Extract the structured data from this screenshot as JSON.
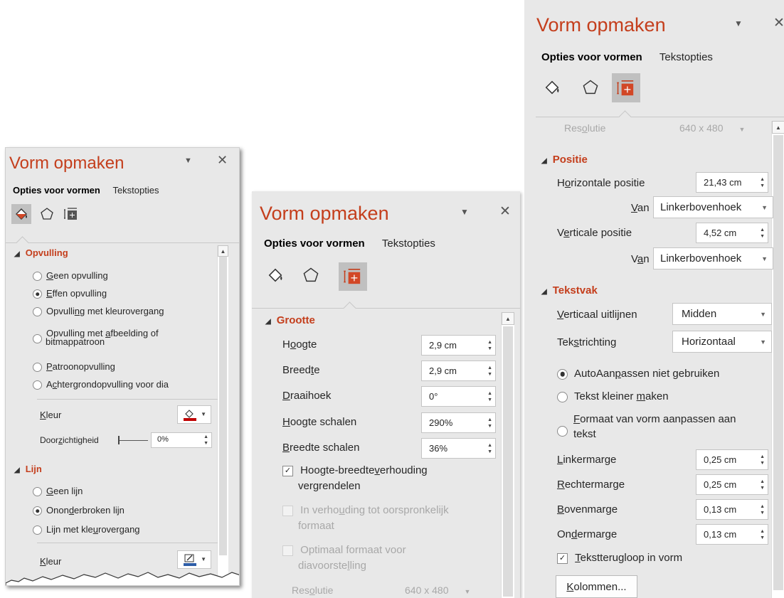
{
  "panel1": {
    "title": "Vorm opmaken",
    "tab_active": "Opties voor vormen",
    "tab_other": "Tekstopties",
    "opvulling_header": "Opvulling",
    "fill_options": [
      {
        "pre": "",
        "u": "G",
        "post": "een opvulling",
        "checked": false
      },
      {
        "pre": "",
        "u": "E",
        "post": "ffen opvulling",
        "checked": true
      },
      {
        "pre": "Opvulli",
        "u": "n",
        "post": "g met kleurovergang",
        "checked": false
      },
      {
        "pre": "Opvulling met ",
        "u": "a",
        "post": "fbeelding of",
        "line2": "bitmappatroon",
        "checked": false
      },
      {
        "pre": "",
        "u": "P",
        "post": "atroonopvulling",
        "checked": false
      },
      {
        "pre": "A",
        "u": "c",
        "post": "htergrondopvulling voor dia",
        "checked": false
      }
    ],
    "kleur_u": "K",
    "kleur_rest": "leur",
    "doorzicht_pre": "Door",
    "doorzicht_u": "z",
    "doorzicht_post": "ichtigheid",
    "doorzicht_value": "0%",
    "lijn_header": "Lijn",
    "line_options": [
      {
        "pre": "",
        "u": "G",
        "post": "een lijn",
        "checked": false
      },
      {
        "pre": "Onon",
        "u": "d",
        "post": "erbroken lijn",
        "checked": true
      },
      {
        "pre": "Lijn met kle",
        "u": "u",
        "post": "rovergang",
        "checked": false
      }
    ],
    "kleur2_u": "K",
    "kleur2_rest": "leur",
    "fill_color": "#c00000",
    "line_color": "#2e5ea8"
  },
  "panel2": {
    "title": "Vorm opmaken",
    "tab_active": "Opties voor vormen",
    "tab_other": "Tekstopties",
    "grootte_header": "Grootte",
    "fields": [
      {
        "pre": "H",
        "u": "o",
        "post": "ogte",
        "value": "2,9 cm"
      },
      {
        "pre": "Breed",
        "u": "t",
        "post": "e",
        "value": "2,9 cm"
      },
      {
        "pre": "",
        "u": "D",
        "post": "raaihoek",
        "value": "0°"
      },
      {
        "pre": "",
        "u": "H",
        "post": "oogte schalen",
        "value": "290%"
      },
      {
        "pre": "",
        "u": "B",
        "post": "reedte schalen",
        "value": "36%"
      }
    ],
    "lock_pre": "Hoogte-breedte",
    "lock_u": "v",
    "lock_post": "erhouding",
    "lock_line2": "vergrendelen",
    "rel_pre": "In verho",
    "rel_u": "u",
    "rel_post": "ding tot oorspronkelijk",
    "rel_line2": "formaat",
    "opt_line1": "Optimaal formaat voor",
    "opt_pre2": "diavoorste",
    "opt_u2": "l",
    "opt_post2": "ling",
    "res_pre": "Res",
    "res_u": "o",
    "res_post": "lutie",
    "res_value": "640 x 480"
  },
  "panel3": {
    "title": "Vorm opmaken",
    "tab_active": "Opties voor vormen",
    "tab_other": "Tekstopties",
    "res_pre": "Res",
    "res_u": "o",
    "res_post": "lutie",
    "res_value": "640 x 480",
    "positie_header": "Positie",
    "hpos_pre": "H",
    "hpos_u": "o",
    "hpos_post": "rizontale positie",
    "hpos_value": "21,43 cm",
    "van_u": "V",
    "van_rest": "an",
    "van_value": "Linkerbovenhoek",
    "vpos_pre": "V",
    "vpos_u": "e",
    "vpos_post": "rticale positie",
    "vpos_value": "4,52 cm",
    "van2_pre": "V",
    "van2_u": "a",
    "van2_post": "n",
    "van2_value": "Linkerbovenhoek",
    "tekstvak_header": "Tekstvak",
    "valign_pre": "",
    "valign_u": "V",
    "valign_post": "erticaal uitlijnen",
    "valign_value": "Midden",
    "tdir_pre": "Tek",
    "tdir_u": "s",
    "tdir_post": "trichting",
    "tdir_value": "Horizontaal",
    "autofit": [
      {
        "pre": "AutoAan",
        "u": "p",
        "post": "assen niet gebruiken",
        "checked": true
      },
      {
        "pre": "Tekst kleiner ",
        "u": "m",
        "post": "aken",
        "checked": false
      }
    ],
    "resize_pre": "",
    "resize_u": "F",
    "resize_post": "ormaat van vorm aanpassen aan",
    "resize_line2": "tekst",
    "margins": [
      {
        "pre": "",
        "u": "L",
        "post": "inkermarge",
        "value": "0,25 cm"
      },
      {
        "pre": "",
        "u": "R",
        "post": "echtermarge",
        "value": "0,25 cm"
      },
      {
        "pre": "",
        "u": "B",
        "post": "ovenmarge",
        "value": "0,13 cm"
      },
      {
        "pre": "On",
        "u": "d",
        "post": "ermarge",
        "value": "0,13 cm"
      }
    ],
    "wrap_pre": "",
    "wrap_u": "T",
    "wrap_post": "ekstterugloop in vorm",
    "cols_pre": "",
    "cols_u": "K",
    "cols_post": "olommen..."
  },
  "icons": {
    "dropdown": "chevron-down-icon",
    "close": "close-icon",
    "fill": "paint-bucket-icon",
    "effects": "pentagon-icon",
    "size": "size-properties-icon"
  },
  "colors": {
    "accent": "#c43e1c",
    "panel_bg": "#e8e8e8",
    "selected_icon_bg": "#c0c0c0"
  }
}
